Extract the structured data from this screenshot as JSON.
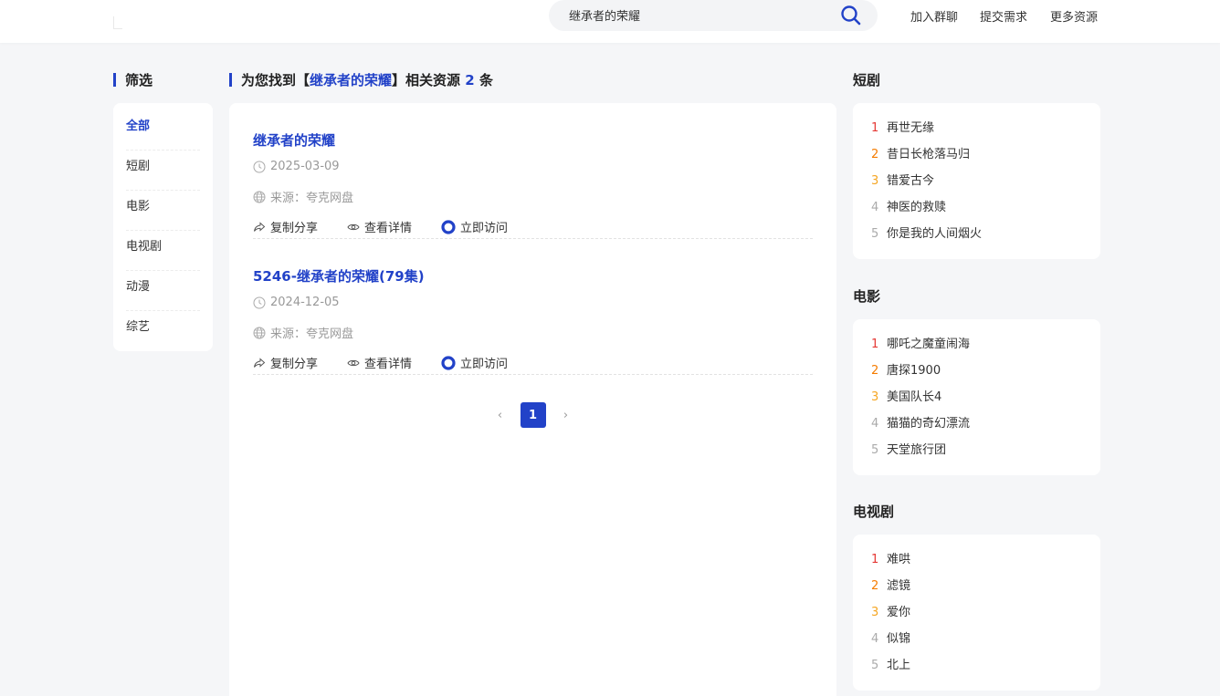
{
  "header": {
    "search_value": "继承者的荣耀",
    "nav": [
      "加入群聊",
      "提交需求",
      "更多资源"
    ]
  },
  "filter": {
    "title": "筛选",
    "items": [
      "全部",
      "短剧",
      "电影",
      "电视剧",
      "动漫",
      "综艺"
    ]
  },
  "results": {
    "title_prefix": "为您找到【",
    "query": "继承者的荣耀",
    "title_mid": "】相关资源",
    "count": "2",
    "title_suffix": "条",
    "items": [
      {
        "title": "继承者的荣耀",
        "date": "2025-03-09",
        "source": "来源：夸克网盘",
        "copy": "复制分享",
        "details": "查看详情",
        "visit": "立即访问"
      },
      {
        "title": "5246-继承者的荣耀(79集)",
        "date": "2024-12-05",
        "source": "来源：夸克网盘",
        "copy": "复制分享",
        "details": "查看详情",
        "visit": "立即访问"
      }
    ],
    "pagination": {
      "prev": "‹",
      "current": "1",
      "next": "›"
    }
  },
  "rankings": [
    {
      "title": "短剧",
      "items": [
        "再世无缘",
        "昔日长枪落马归",
        "错爱古今",
        "神医的救赎",
        "你是我的人间烟火"
      ]
    },
    {
      "title": "电影",
      "items": [
        "哪吒之魔童闹海",
        "唐探1900",
        "美国队长4",
        "猫猫的奇幻漂流",
        "天堂旅行团"
      ]
    },
    {
      "title": "电视剧",
      "items": [
        "难哄",
        "滤镜",
        "爱你",
        "似锦",
        "北上"
      ]
    }
  ],
  "colors": {
    "accent": "#2242c8",
    "rank1": "#e53935",
    "rank2": "#f57c00",
    "rank3": "#f5a623",
    "rank_other": "#aaaaaa"
  }
}
